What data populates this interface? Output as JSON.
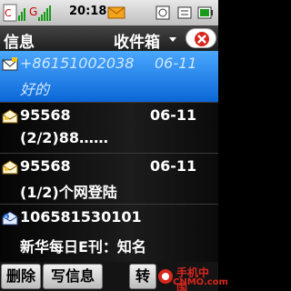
{
  "status_bar": {
    "time": "20:18",
    "icons": [
      "signal-icon",
      "signal-2-icon",
      "message-icon",
      "battery-icon"
    ]
  },
  "header": {
    "title": "信息",
    "folder": "收件箱",
    "close_icon": "close-icon"
  },
  "messages": [
    {
      "icon": "unread-envelope-icon",
      "sender": "+86151002038",
      "date": "06-11",
      "preview": "好的",
      "selected": true
    },
    {
      "icon": "read-envelope-icon",
      "sender": "95568",
      "date": "06-11",
      "preview": "(2/2)88……",
      "selected": false
    },
    {
      "icon": "read-envelope-icon",
      "sender": "95568",
      "date": "06-11",
      "preview": "(1/2)个网登陆",
      "selected": false
    },
    {
      "icon": "service-message-icon",
      "sender": "106581530101",
      "date": "",
      "preview": "新华每日E刊：知名",
      "selected": false
    }
  ],
  "softkeys": {
    "delete": "删除",
    "compose": "写信息",
    "right": "转"
  },
  "watermark": {
    "line1": "手机中国",
    "line2": "CNMO.com"
  },
  "colors": {
    "selection": "#1a7ae6",
    "close_accent": "#d9261c"
  }
}
